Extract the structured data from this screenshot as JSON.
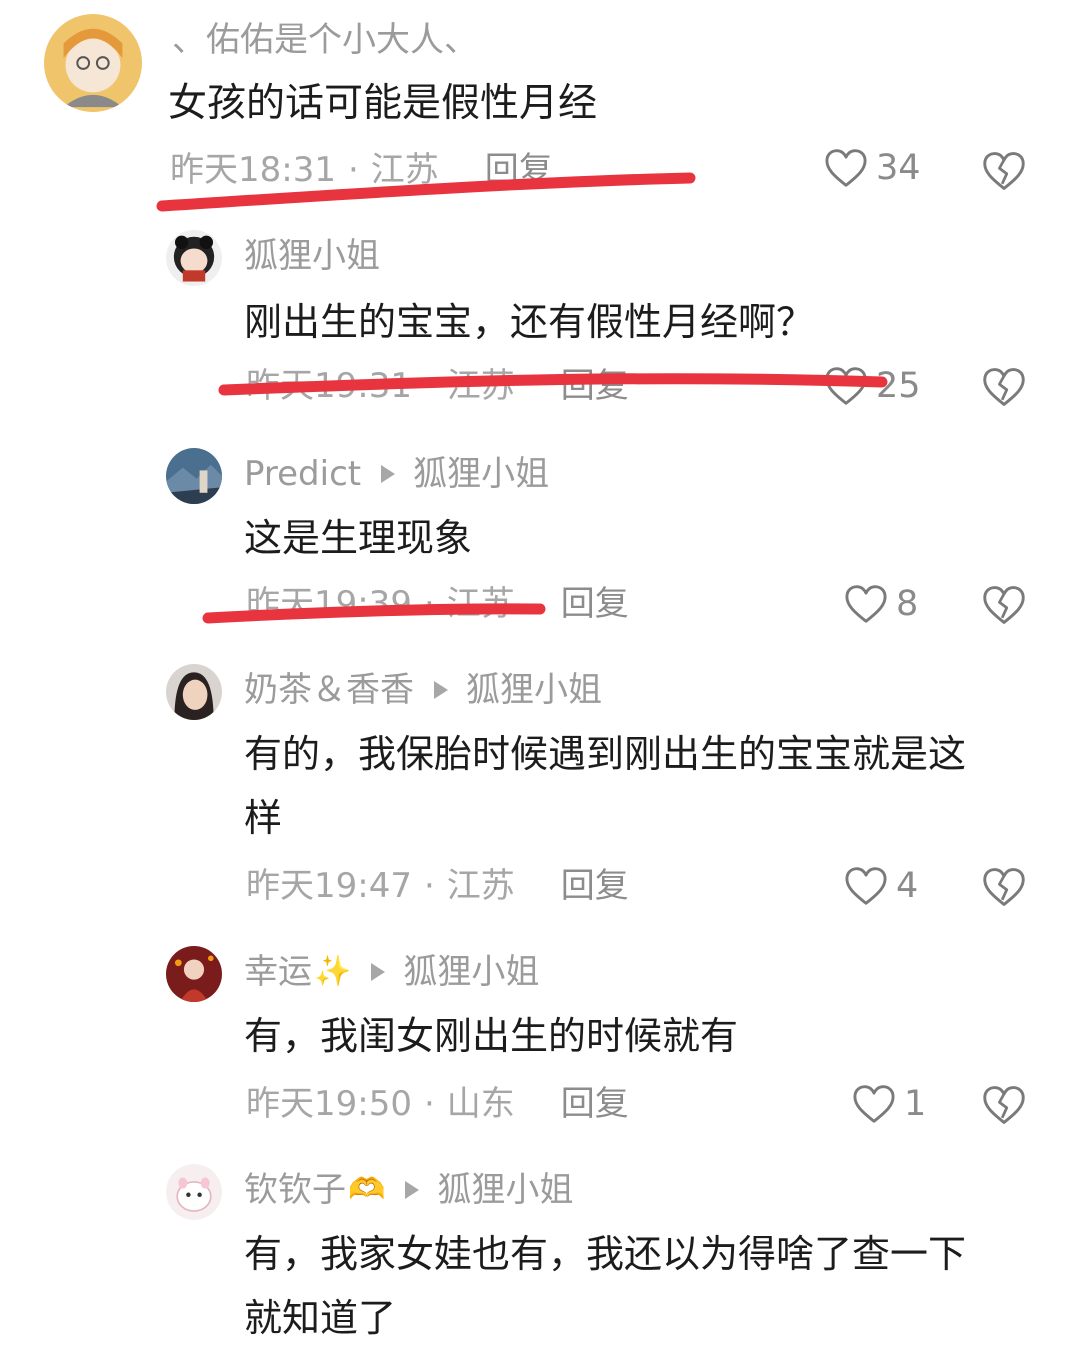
{
  "comments": [
    {
      "username": "、佑佑是个小大人、",
      "text": "女孩的话可能是假性月经",
      "time": "昨天18:31",
      "location": "江苏",
      "reply_label": "回复",
      "likes": "34"
    },
    {
      "username": "狐狸小姐",
      "text": "刚出生的宝宝，还有假性月经啊？",
      "time": "昨天19:31",
      "location": "江苏",
      "reply_label": "回复",
      "likes": "25"
    },
    {
      "username": "Predict",
      "reply_to": "狐狸小姐",
      "text": "这是生理现象",
      "time": "昨天19:39",
      "location": "江苏",
      "reply_label": "回复",
      "likes": "8"
    },
    {
      "username": "奶茶＆香香",
      "reply_to": "狐狸小姐",
      "text": "有的，我保胎时候遇到刚出生的宝宝就是这\n样",
      "time": "昨天19:47",
      "location": "江苏",
      "reply_label": "回复",
      "likes": "4"
    },
    {
      "username": "幸运",
      "username_emoji": "✨",
      "reply_to": "狐狸小姐",
      "text": "有，我闺女刚出生的时候就有",
      "time": "昨天19:50",
      "location": "山东",
      "reply_label": "回复",
      "likes": "1"
    },
    {
      "username": "钦钦子",
      "username_emoji": "🫶",
      "reply_to": "狐狸小姐",
      "text": "有，我家女娃也有，我还以为得啥了查一下\n就知道了"
    }
  ],
  "icons": {
    "like": "heart-outline-icon",
    "dislike": "broken-heart-icon",
    "reply_arrow": "play-triangle-icon"
  },
  "colors": {
    "annotation_red": "#e8343f",
    "meta_gray": "#a6a6a6"
  }
}
